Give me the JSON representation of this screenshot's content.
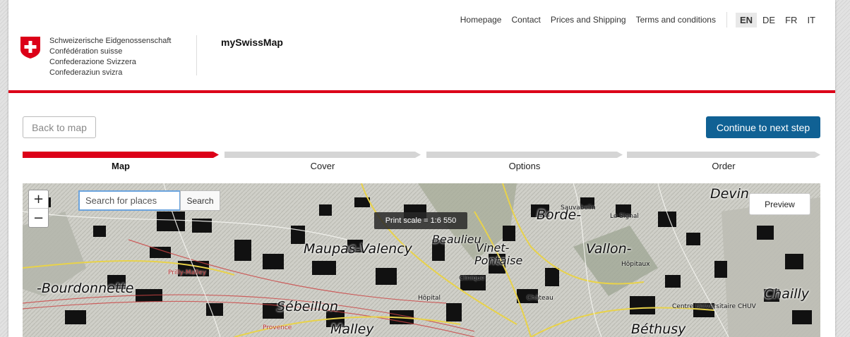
{
  "topnav": {
    "links": [
      "Homepage",
      "Contact",
      "Prices and Shipping",
      "Terms and conditions"
    ],
    "languages": [
      "EN",
      "DE",
      "FR",
      "IT"
    ],
    "active_language": "EN"
  },
  "brand": {
    "confederation": [
      "Schweizerische Eidgenossenschaft",
      "Confédération suisse",
      "Confederazione Svizzera",
      "Confederaziun svizra"
    ],
    "app_name": "mySwissMap",
    "accent_color": "#dc0018"
  },
  "actions": {
    "back_label": "Back to map",
    "next_label": "Continue to next step",
    "next_color": "#106194"
  },
  "steps": [
    {
      "label": "Map",
      "active": true
    },
    {
      "label": "Cover",
      "active": false
    },
    {
      "label": "Options",
      "active": false
    },
    {
      "label": "Order",
      "active": false
    }
  ],
  "map": {
    "zoom_in": "+",
    "zoom_out": "−",
    "search_placeholder": "Search for places",
    "search_button": "Search",
    "scale_text": "Print scale = 1:6 550",
    "preview_label": "Preview",
    "places": {
      "maupas": "Maupas-Valency",
      "bourdonnette": "-Bourdonnette",
      "sebeillon": "Sébeillon",
      "malley": "Malley",
      "beaulieu": "Beaulieu",
      "vinet": "Vinet-",
      "pontaise": "Pontaise",
      "borde": "Borde-",
      "vallon": "Vallon-",
      "devin": "Devin",
      "chailly": "Chailly",
      "bethusy": "Béthusy",
      "prilly": "Prilly-Malley",
      "chuv": "Centre Universitaire CHUV",
      "hopital": "Hôpital",
      "chateau": "Château",
      "hopitaux": "Hôpitaux",
      "clinique": "Clinique",
      "sauvabelin": "Sauvabelin",
      "signal": "Le Signal",
      "provence": "Provence"
    }
  }
}
